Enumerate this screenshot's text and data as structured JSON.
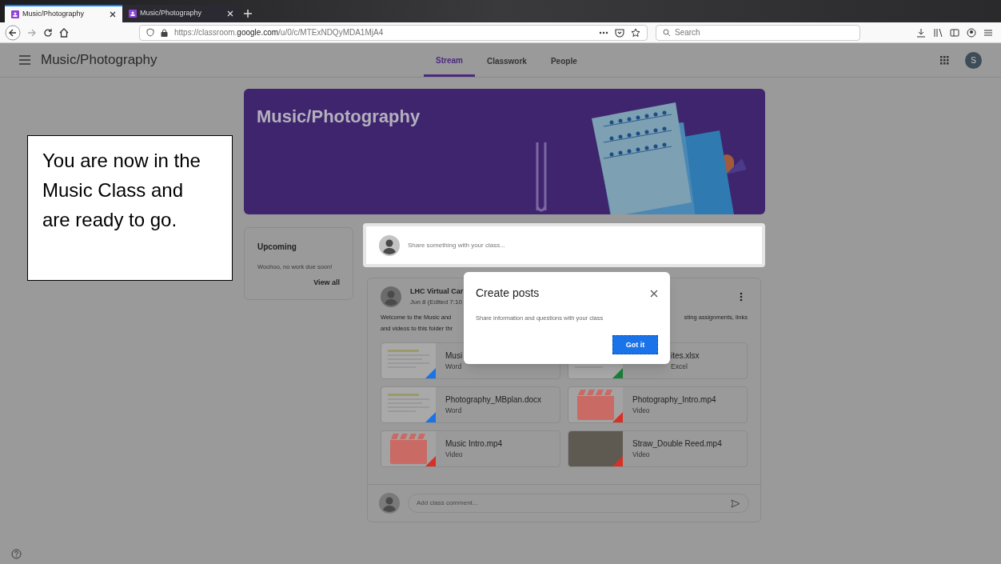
{
  "browser": {
    "tabs": [
      {
        "title": "Music/Photography",
        "selected": true
      },
      {
        "title": "Music/Photography",
        "selected": false
      }
    ],
    "url": "https://classroom.**google.com**/u/0/c/MTExNDQyMDA1MjA4",
    "search_placeholder": "Search"
  },
  "app": {
    "title": "Music/Photography",
    "nav_tabs": [
      {
        "label": "Stream",
        "selected": true
      },
      {
        "label": "Classwork",
        "selected": false
      },
      {
        "label": "People",
        "selected": false
      }
    ],
    "avatar": "S"
  },
  "banner": {
    "title": "Music/Photography"
  },
  "upcoming": {
    "title": "Upcoming",
    "message": "Woohoo, no work due soon!",
    "link": "View all"
  },
  "share": {
    "placeholder": "Share something with your class..."
  },
  "post": {
    "author": "LHC Virtual Car",
    "date": "Jun 8 (Edited 7:10",
    "text_lines": [
      {
        "left": "Welcome to the Music and",
        "right": "sting assignments, links"
      },
      {
        "left": "and videos to this folder thr"
      }
    ],
    "attachments": [
      {
        "name": "Musi",
        "type": "Word",
        "kind": "doc",
        "color": "#1a73e8"
      },
      {
        "name": "ites.xlsx",
        "type": "Excel",
        "kind": "doc",
        "color": "#188038"
      },
      {
        "name": "Photography_MBplan.docx",
        "type": "Word",
        "kind": "doc",
        "color": "#1a73e8"
      },
      {
        "name": "Photography_Intro.mp4",
        "type": "Video",
        "kind": "video",
        "color": "#d93025"
      },
      {
        "name": "Music Intro.mp4",
        "type": "Video",
        "kind": "video",
        "color": "#d93025"
      },
      {
        "name": "Straw_Double Reed.mp4",
        "type": "Video",
        "kind": "photo",
        "color": "#d93025"
      }
    ],
    "comment_placeholder": "Add class comment..."
  },
  "dialog": {
    "title": "Create posts",
    "text": "Share information and questions with your class",
    "button": "Got it"
  },
  "callout": {
    "text": "You are now in the Music Class and are ready to go."
  }
}
